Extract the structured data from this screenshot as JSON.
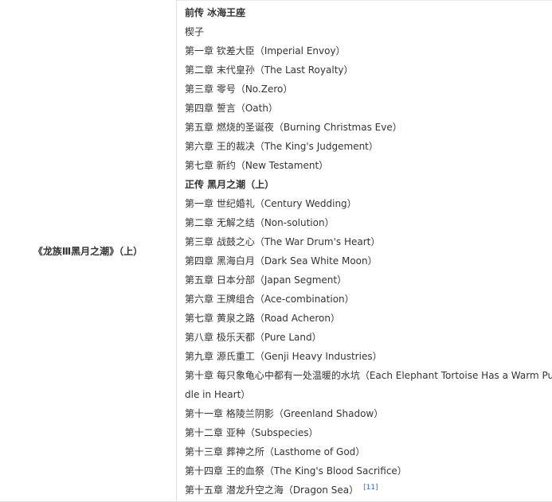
{
  "book_title": "《龙族Ⅲ黑月之潮》（上）",
  "lines": [
    {
      "text": "前传 冰海王座",
      "bold": true
    },
    {
      "text": "楔子"
    },
    {
      "text": "第一章 钦差大臣（Imperial Envoy）"
    },
    {
      "text": "第二章 末代皇孙（The Last Royalty）"
    },
    {
      "text": "第三章 零号（No.Zero）"
    },
    {
      "text": "第四章 誓言（Oath）"
    },
    {
      "text": "第五章 燃烧的圣诞夜（Burning Christmas Eve）"
    },
    {
      "text": "第六章 王的裁决（The King's Judgement）"
    },
    {
      "text": "第七章 新约（New Testament）"
    },
    {
      "text": "正传 黑月之潮（上）",
      "bold": true
    },
    {
      "text": "第一章 世纪婚礼（Century Wedding）"
    },
    {
      "text": "第二章 无解之结（Non-solution）"
    },
    {
      "text": "第三章 战鼓之心（The War Drum's Heart）"
    },
    {
      "text": "第四章 黑海白月（Dark Sea White Moon）"
    },
    {
      "text": "第五章 日本分部（Japan Segment）"
    },
    {
      "text": "第六章 王牌组合（Ace-combination）"
    },
    {
      "text": "第七章 黄泉之路（Road Acheron）"
    },
    {
      "text": "第八章 极乐天都（Pure Land）"
    },
    {
      "text": "第九章 源氏重工（Genji Heavy Industries）"
    },
    {
      "text": "第十章 每只象龟心中都有一处温暖的水坑（Each Elephant Tortoise Has a Warm Pud"
    },
    {
      "text": "dle in Heart）"
    },
    {
      "text": "第十一章 格陵兰阴影（Greenland Shadow）"
    },
    {
      "text": "第十二章 亚种（Subspecies）"
    },
    {
      "text": "第十三章 葬神之所（Lasthome of God）"
    },
    {
      "text": "第十四章 王的血祭（The King's Blood Sacrifice）"
    },
    {
      "text": "第十五章 潜龙升空之海（Dragon Sea）",
      "ref": "[11]"
    }
  ]
}
